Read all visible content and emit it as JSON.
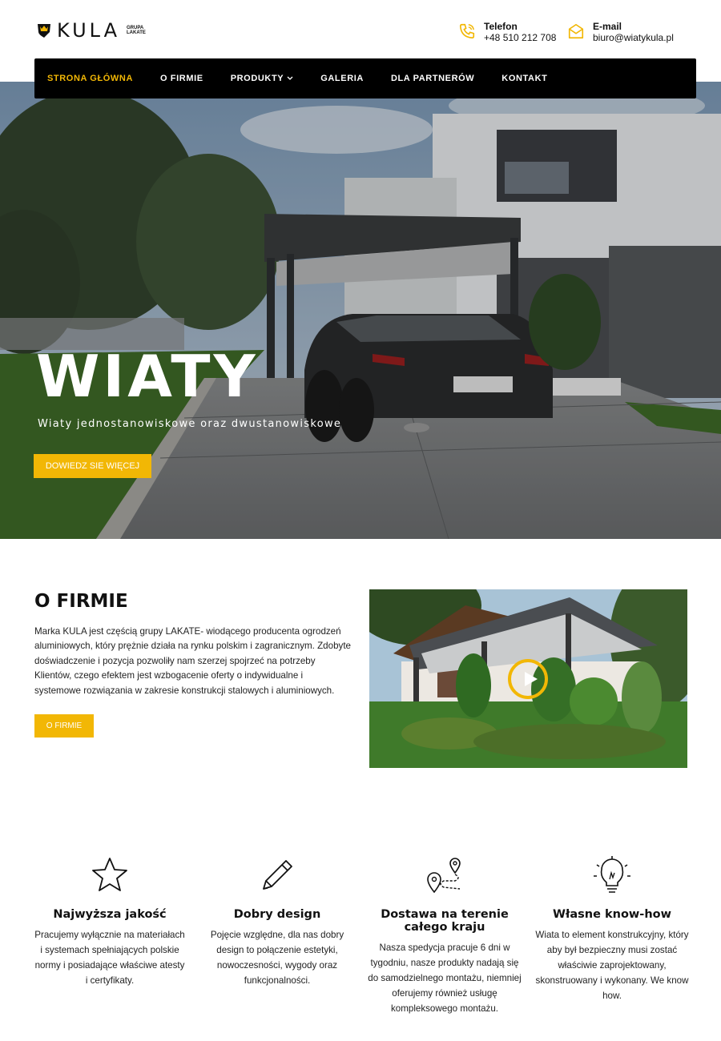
{
  "brand": {
    "name": "KULA",
    "group_line1": "GRUPA",
    "group_line2": "LAKATE"
  },
  "contacts": [
    {
      "label": "Telefon",
      "value": "+48 510 212 708",
      "icon": "phone-icon"
    },
    {
      "label": "E-mail",
      "value": "biuro@wiatykula.pl",
      "icon": "envelope-icon"
    }
  ],
  "nav": {
    "items": [
      {
        "label": "STRONA GŁÓWNA",
        "active": true
      },
      {
        "label": "O FIRMIE"
      },
      {
        "label": "PRODUKTY",
        "has_dropdown": true
      },
      {
        "label": "GALERIA"
      },
      {
        "label": "DLA PARTNERÓW"
      },
      {
        "label": "KONTAKT"
      }
    ]
  },
  "hero": {
    "title": "WIATY",
    "subtitle": "Wiaty jednostanowiskowe oraz dwustanowiskowe",
    "button": "DOWIEDZ SIE WIĘCEJ"
  },
  "about": {
    "title": "O FIRMIE",
    "text": "Marka KULA jest częścią grupy LAKATE- wiodącego producenta ogrodzeń aluminiowych, który prężnie działa na rynku polskim i zagranicznym. Zdobyte doświadczenie i pozycja pozwoliły nam szerzej spojrzeć na potrzeby Klientów, czego efektem jest wzbogacenie oferty o indywidualne i systemowe rozwiązania w zakresie konstrukcji stalowych i aluminiowych.",
    "button": "O FIRMIE"
  },
  "features": [
    {
      "title": "Najwyższa jakość",
      "text": "Pracujemy wyłącznie na materiałach i systemach spełniających polskie normy i posiadające właściwe atesty i certyfikaty.",
      "icon": "star-icon"
    },
    {
      "title": "Dobry design",
      "text": "Pojęcie względne, dla nas dobry design to połączenie estetyki, nowoczesności, wygody oraz funkcjonalności.",
      "icon": "pencil-icon"
    },
    {
      "title": "Dostawa na terenie całego kraju",
      "text": "Nasza spedycja pracuje 6 dni w tygodniu, nasze produkty nadają się do samodzielnego montażu, niemniej oferujemy również usługę kompleksowego montażu.",
      "icon": "route-pin-icon"
    },
    {
      "title": "Własne know-how",
      "text": "Wiata to element konstrukcyjny, który aby był bezpieczny musi zostać właściwie zaprojektowany, skonstruowany i wykonany. We know how.",
      "icon": "lightbulb-icon"
    }
  ],
  "colors": {
    "accent": "#f2b705",
    "nav_bg": "#000000"
  }
}
